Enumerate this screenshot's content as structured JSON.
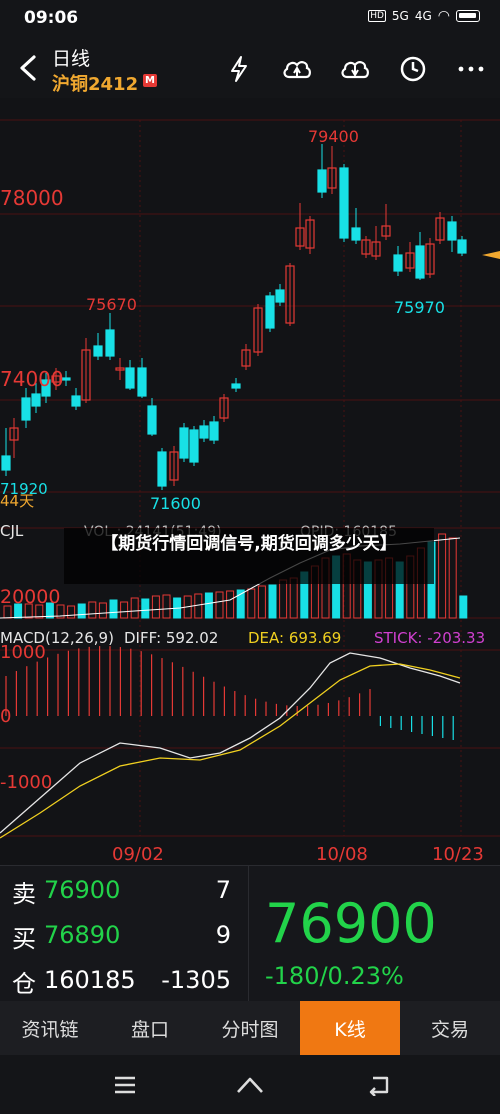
{
  "status": {
    "time": "09:06",
    "net1": "HD",
    "net2": "5G",
    "net3": "4G"
  },
  "header": {
    "period": "日线",
    "contract": "沪铜2412",
    "badge": "M"
  },
  "chart": {
    "price_labels": {
      "high": "79400",
      "p78000": "78000",
      "h2": "75670",
      "r_low": "75970",
      "p74000": "74000",
      "low1": "71920",
      "low2": "71600",
      "days": "44天"
    },
    "vol": {
      "name": "CJL",
      "vol_text": "VOL : 24141(51:49)",
      "opid_text": "OPID: 160185",
      "level": "20000"
    },
    "macd": {
      "title": "MACD(12,26,9)",
      "diff": "DIFF: 592.02",
      "dea": "DEA: 693.69",
      "stick": "STICK: -203.33",
      "y_top": "1000",
      "y_mid": "0",
      "y_low": "-1000"
    },
    "dates": [
      "09/02",
      "10/08",
      "10/23"
    ]
  },
  "article_title": "【期货行情回调信号,期货回调多少天】",
  "quote": {
    "sell_label": "卖",
    "sell_price": "76900",
    "sell_vol": "7",
    "buy_label": "买",
    "buy_price": "76890",
    "buy_vol": "9",
    "oi_label": "仓",
    "oi_value": "160185",
    "oi_change": "-1305",
    "last": "76900",
    "change": "-180/0.23%"
  },
  "tabs": [
    "资讯链",
    "盘口",
    "分时图",
    "K线",
    "交易"
  ],
  "colors": {
    "up": "#e53935",
    "down": "#18e0e6",
    "accent": "#f07812",
    "green": "#22d34a"
  },
  "icons": [
    "back-icon",
    "flash-icon",
    "cloud-up-icon",
    "cloud-down-icon",
    "clock-icon",
    "more-icon",
    "menu-icon",
    "home-icon",
    "back-nav-icon"
  ]
}
